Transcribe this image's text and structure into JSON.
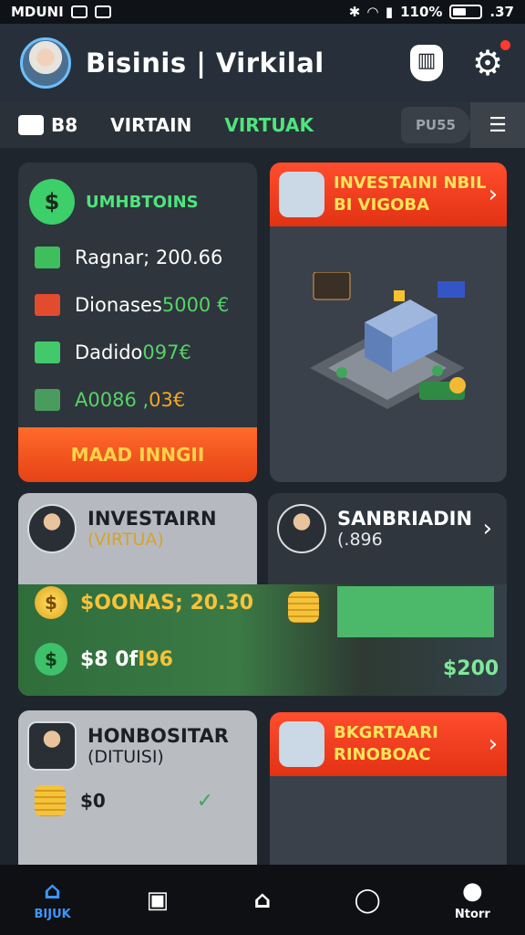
{
  "status_bar": {
    "left_text": "MDUNI",
    "right_text": "110%",
    "time": ".37"
  },
  "header": {
    "title": "Bisinis | Virkilal"
  },
  "tabs": {
    "first": "B8",
    "second": "VIRTAIN",
    "third": "VIRTUAK",
    "fourth": "PU55"
  },
  "card_summary": {
    "title": "UMHBTOINS",
    "rows": [
      {
        "label": "Ragnar; 200.66",
        "value": ""
      },
      {
        "label": "Dionases ",
        "value": "5000 €"
      },
      {
        "label": "Dadido ",
        "value": "097€"
      },
      {
        "label": "A0086 ,",
        "value": "03€"
      }
    ],
    "button": "MAAD INNGII"
  },
  "card_invest": {
    "line1": "INVESTAINI NBIL",
    "line2": "BI VIGOBA"
  },
  "card_investor": {
    "title": "INVESTAIRN",
    "subtitle": "(VIRTUA)"
  },
  "card_sanbriadin": {
    "title": "SANBRIADIN",
    "subtitle": "(.896"
  },
  "band": {
    "row1": "$OONAS; 20.30",
    "row2_prefix": "$8 0f ",
    "row2_value": "I96",
    "right_value": "$200"
  },
  "card_hon": {
    "title": "HONBOSITAR",
    "subtitle": "(DITUISI)",
    "amount": "$0"
  },
  "card_bkg": {
    "title": "BKGRTAARI",
    "subtitle": "RINOBOAC"
  },
  "bottom_nav": [
    {
      "label": "BIJUK",
      "icon": "home-icon",
      "active": true
    },
    {
      "label": "",
      "icon": "chart-icon",
      "active": false
    },
    {
      "label": "",
      "icon": "house-outline-icon",
      "active": false
    },
    {
      "label": "",
      "icon": "person-outline-icon",
      "active": false
    },
    {
      "label": "Ntorr",
      "icon": "profile-icon",
      "active": false
    }
  ],
  "colors": {
    "accent_green": "#4fe47c",
    "accent_orange": "#ff5a25",
    "bg": "#1f252d",
    "nav_active": "#3b97ff"
  }
}
